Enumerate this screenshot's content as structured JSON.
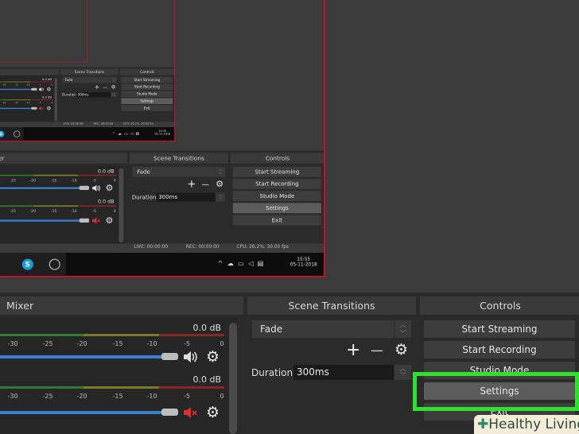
{
  "mixer": {
    "header": "Mixer",
    "ticks": [
      "-30",
      "-25",
      "-20",
      "-15",
      "-10",
      "-5",
      "0"
    ],
    "channels": [
      {
        "db": "0.0 dB",
        "muted": false
      },
      {
        "db": "0.0 dB",
        "muted": true
      }
    ]
  },
  "transitions": {
    "header": "Scene Transitions",
    "selected": "Fade",
    "add": "+",
    "remove": "—",
    "duration_label": "Duration",
    "duration_value": "300ms"
  },
  "controls": {
    "header": "Controls",
    "buttons": [
      "Start Streaming",
      "Start Recording",
      "Studio Mode",
      "Settings",
      "Exit"
    ],
    "highlighted": "Settings"
  },
  "status": {
    "live": "LIVE: 00:00:00",
    "rec": "REC: 00:00:00",
    "cpu": "CPU: 26.2%, 30.00 fps"
  },
  "taskbar": {
    "time": "15:55",
    "date": "05-11-2018"
  },
  "watermark": "Healthy Living",
  "colors": {
    "highlight": "#2fe02f",
    "preview_border": "#c8102e",
    "fader": "#3c7fd0"
  }
}
